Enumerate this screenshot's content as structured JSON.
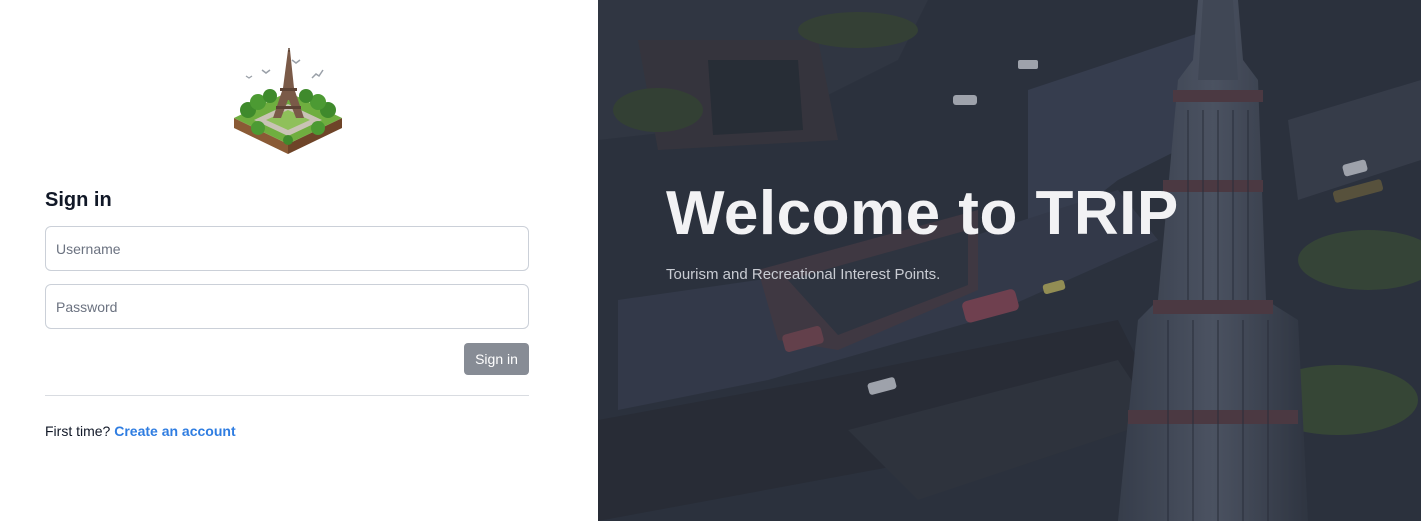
{
  "signin": {
    "title": "Sign in",
    "username_placeholder": "Username",
    "password_placeholder": "Password",
    "submit_label": "Sign in"
  },
  "register": {
    "prompt": "First time?",
    "link_label": "Create an account"
  },
  "hero": {
    "title": "Welcome to TRIP",
    "subtitle": "Tourism and Recreational Interest Points."
  },
  "icons": {
    "logo": "eiffel-tower-isometric-logo"
  }
}
